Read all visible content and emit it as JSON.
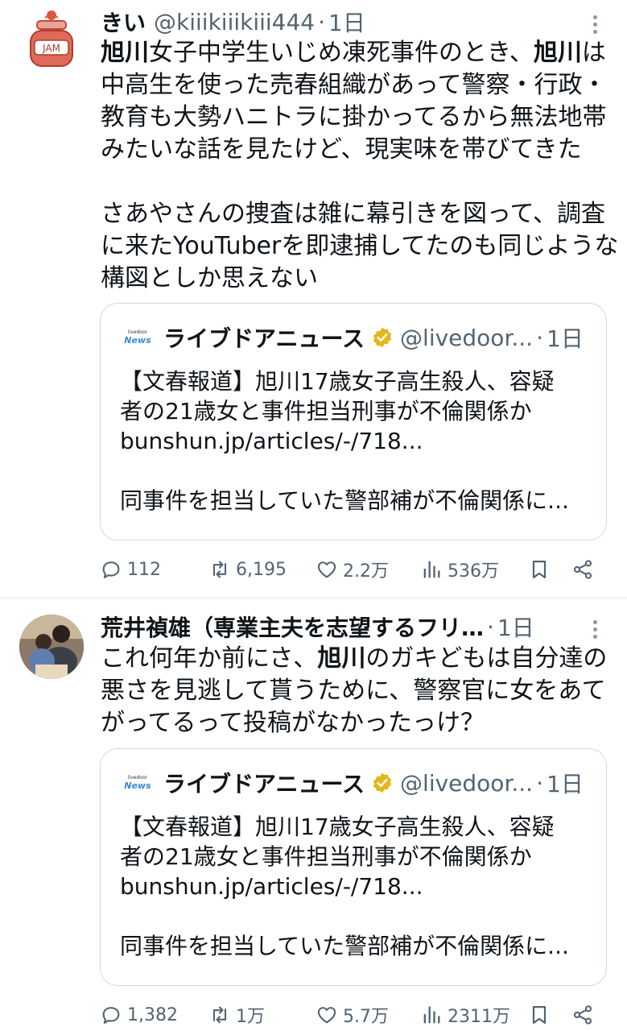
{
  "tweets": [
    {
      "name": "きい",
      "handle": "@kiiikiiikiii444",
      "time": "1日",
      "body_lines": [
        [
          {
            "t": "旭川",
            "b": true
          },
          {
            "t": "女子中学生いじめ凍死事件のとき、"
          },
          {
            "t": "旭川",
            "b": true
          },
          {
            "t": "は"
          }
        ],
        [
          {
            "t": "中高生を使った売春組織があって警察・行政・"
          }
        ],
        [
          {
            "t": "教育も大勢ハニトラに掛かってるから無法地帯"
          }
        ],
        [
          {
            "t": "みたいな話を見たけど、現実味を帯びてきた"
          }
        ],
        [],
        [
          {
            "t": "さあやさんの捜査は雑に幕引きを図って、調査"
          }
        ],
        [
          {
            "t": "に来たYouTuberを即逮捕してたのも同じような"
          }
        ],
        [
          {
            "t": "構図としか思えない"
          }
        ]
      ],
      "avatar_label": "JAM",
      "quote": {
        "logo_small": "livedoor",
        "logo_main": "News",
        "name": "ライブドアニュース",
        "handle": "@livedoor...",
        "time": "1日",
        "lines": [
          "【文春報道】旭川17歳女子高生殺人、容疑",
          "者の21歳女と事件担当刑事が不倫関係か",
          "bunshun.jp/articles/-/718..."
        ],
        "summary": "同事件を担当していた警部補が不倫関係に..."
      },
      "actions": {
        "replies": "112",
        "retweets": "6,195",
        "likes": "2.2万",
        "views": "536万"
      }
    },
    {
      "name": "荒井禎雄（専業主夫を志望するフリ…",
      "handle": "",
      "time": "1日",
      "body_lines": [
        [
          {
            "t": "これ何年か前にさ、"
          },
          {
            "t": "旭川",
            "b": true
          },
          {
            "t": "のガキどもは自分達の"
          }
        ],
        [
          {
            "t": "悪さを見逃して貰うために、警察官に女をあて"
          }
        ],
        [
          {
            "t": "がってるって投稿がなかったっけ？"
          }
        ]
      ],
      "quote": {
        "logo_small": "livedoor",
        "logo_main": "News",
        "name": "ライブドアニュース",
        "handle": "@livedoor...",
        "time": "1日",
        "lines": [
          "【文春報道】旭川17歳女子高生殺人、容疑",
          "者の21歳女と事件担当刑事が不倫関係か",
          "bunshun.jp/articles/-/718..."
        ],
        "summary": "同事件を担当していた警部補が不倫関係に..."
      },
      "actions": {
        "replies": "1,382",
        "retweets": "1万",
        "likes": "5.7万",
        "views": "2311万"
      }
    }
  ],
  "icons": {
    "reply": "reply-icon",
    "retweet": "retweet-icon",
    "like": "heart-icon",
    "views": "views-icon",
    "bookmark": "bookmark-icon",
    "share": "share-icon",
    "more": "more-icon",
    "verified": "verified-badge-icon"
  },
  "colors": {
    "text": "#0f1419",
    "secondary": "#536471",
    "verified_gold": "#e2b719",
    "border": "#cfd9de"
  }
}
